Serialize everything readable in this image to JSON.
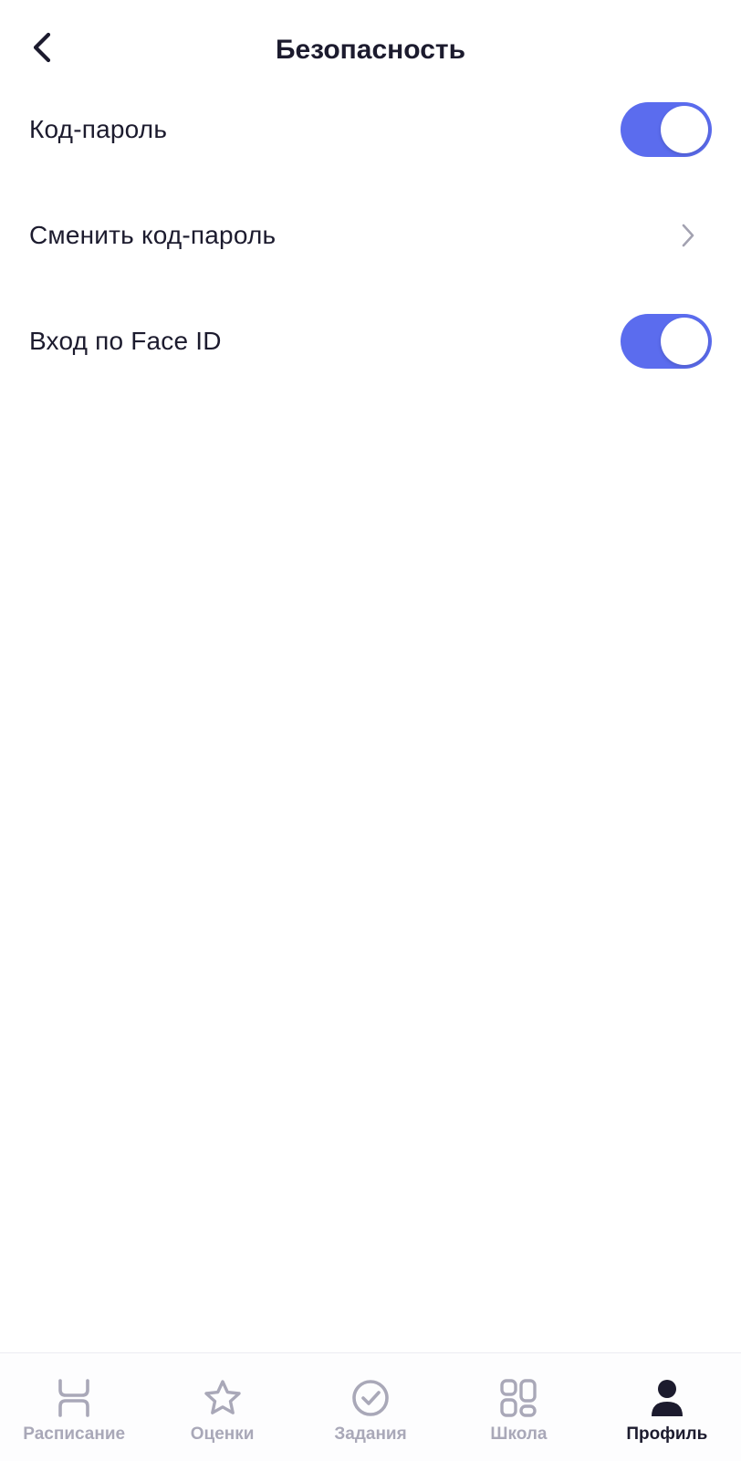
{
  "header": {
    "title": "Безопасность",
    "back_icon": "chevron-left-icon"
  },
  "settings": {
    "passcode": {
      "label": "Код-пароль",
      "enabled": true
    },
    "change_passcode": {
      "label": "Сменить код-пароль",
      "icon": "chevron-right-icon"
    },
    "face_id": {
      "label": "Вход по Face ID",
      "enabled": true
    }
  },
  "tab_bar": {
    "tabs": [
      {
        "label": "Расписание",
        "icon": "schedule-icon",
        "active": false
      },
      {
        "label": "Оценки",
        "icon": "star-icon",
        "active": false
      },
      {
        "label": "Задания",
        "icon": "check-circle-icon",
        "active": false
      },
      {
        "label": "Школа",
        "icon": "grid-icon",
        "active": false
      },
      {
        "label": "Профиль",
        "icon": "user-icon",
        "active": true
      }
    ]
  },
  "colors": {
    "accent": "#5b6cee",
    "text_primary": "#1c1b2e",
    "tab_inactive": "#a9a8b8",
    "chevron": "#a3a2b1"
  }
}
